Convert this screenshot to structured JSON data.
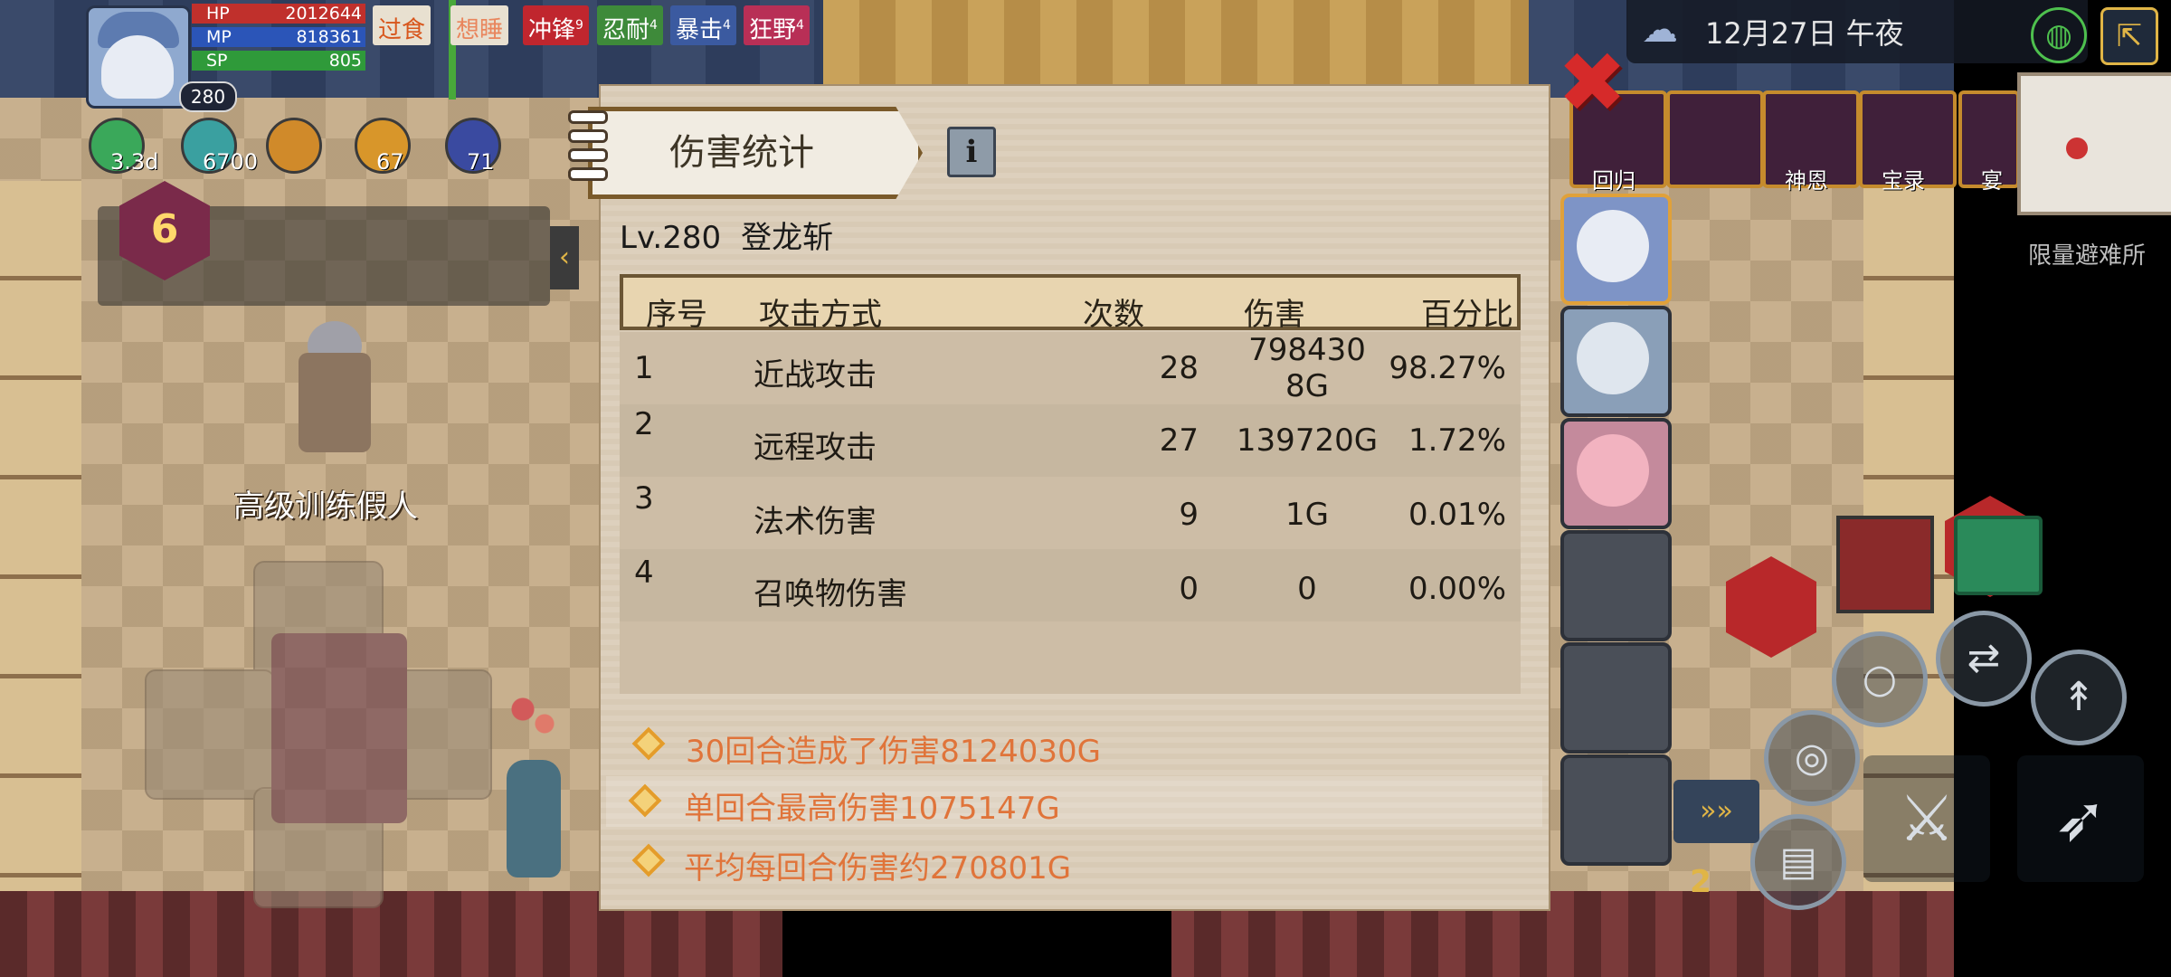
{
  "player": {
    "level": "280",
    "hp_label": "HP",
    "hp_value": "2012644",
    "mp_label": "MP",
    "mp_value": "818361",
    "sp_label": "SP",
    "sp_value": "805"
  },
  "buffs": [
    {
      "label": "过食",
      "sup": "",
      "color": "#e8e0d0",
      "text": "#d8561c"
    },
    {
      "label": "想睡",
      "sup": "",
      "color": "#e8e0d0",
      "text": "#e9855c"
    },
    {
      "label": "冲锋",
      "sup": "9",
      "color": "#c0262e",
      "text": "#ffffff"
    },
    {
      "label": "忍耐",
      "sup": "4",
      "color": "#3e8a3a",
      "text": "#ffffff"
    },
    {
      "label": "暴击",
      "sup": "4",
      "color": "#3b5aa0",
      "text": "#ffffff"
    },
    {
      "label": "狂野",
      "sup": "4",
      "color": "#b82f56",
      "text": "#ffffff"
    }
  ],
  "resources": [
    {
      "icon": "leaf-gem-icon",
      "value": "3.3d"
    },
    {
      "icon": "green-orb-icon",
      "value": "6700"
    },
    {
      "icon": "gold-coin-icon",
      "value": ""
    },
    {
      "icon": "shield-badge-icon",
      "value": "67"
    },
    {
      "icon": "star-badge-icon",
      "value": "71"
    }
  ],
  "skill_level": "6",
  "dummy_name": "高级训练假人",
  "weather": {
    "date_time": "12月27日 午夜"
  },
  "top_icons": [
    {
      "label": "回归",
      "icon": "lion-icon"
    },
    {
      "label": "",
      "icon": "purple-crystal-icon"
    },
    {
      "label": "神恩",
      "icon": "shrine-icon"
    },
    {
      "label": "宝录",
      "icon": "book-icon"
    },
    {
      "label": "宴",
      "icon": "feast-icon"
    }
  ],
  "area_name": "限量避难所",
  "panel": {
    "title": "伤害统计",
    "level_text": "Lv.280",
    "skill_name": "登龙斩",
    "columns": [
      "序号",
      "攻击方式",
      "次数",
      "伤害",
      "百分比"
    ],
    "rows": [
      {
        "index": "1",
        "type": "近战攻击",
        "count": "28",
        "damage_line1": "798430",
        "damage_line2": "8G",
        "percent": "98.27%"
      },
      {
        "index": "2",
        "type": "远程攻击",
        "count": "27",
        "damage_line1": "139720G",
        "damage_line2": "",
        "percent": "1.72%"
      },
      {
        "index": "3",
        "type": "法术伤害",
        "count": "9",
        "damage_line1": "1G",
        "damage_line2": "",
        "percent": "0.01%"
      },
      {
        "index": "4",
        "type": "召唤物伤害",
        "count": "0",
        "damage_line1": "0",
        "damage_line2": "",
        "percent": "0.00%"
      }
    ],
    "summaries": [
      "30回合造成了伤害8124030G",
      "单回合最高伤害1075147G",
      "平均每回合伤害约270801G"
    ]
  },
  "bottom_badge": "2",
  "colors": {
    "accent_orange": "#e0743a",
    "close_red": "#d62a2a",
    "panel_border": "#6b5635"
  }
}
